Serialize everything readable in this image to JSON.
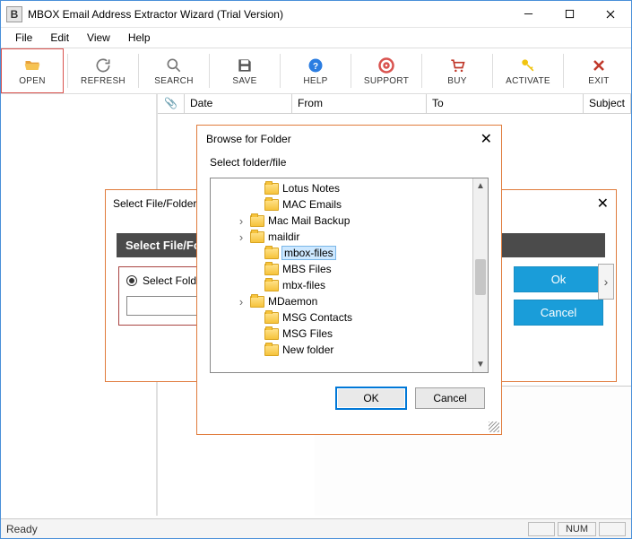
{
  "window": {
    "title": "MBOX Email Address Extractor Wizard (Trial Version)",
    "app_badge": "B"
  },
  "menu": {
    "file": "File",
    "edit": "Edit",
    "view": "View",
    "help": "Help"
  },
  "toolbar": {
    "open": "OPEN",
    "refresh": "REFRESH",
    "search": "SEARCH",
    "save": "SAVE",
    "help": "HELP",
    "support": "SUPPORT",
    "buy": "BUY",
    "activate": "ACTIVATE",
    "exit": "EXIT"
  },
  "columns": {
    "date": "Date",
    "from": "From",
    "to": "To",
    "subject": "Subject"
  },
  "status": {
    "ready": "Ready",
    "num": "NUM"
  },
  "select_dialog": {
    "title": "Select File/Folder",
    "header": "Select File/Folder",
    "radio_label": "Select Folder",
    "input_value": "",
    "ok": "Ok",
    "cancel": "Cancel"
  },
  "browse_dialog": {
    "title": "Browse for Folder",
    "subtitle": "Select folder/file",
    "items": [
      {
        "label": "Lotus Notes",
        "hasArrow": false
      },
      {
        "label": "MAC Emails",
        "hasArrow": false
      },
      {
        "label": "Mac Mail Backup",
        "hasArrow": true
      },
      {
        "label": "maildir",
        "hasArrow": true
      },
      {
        "label": "mbox-files",
        "hasArrow": false,
        "selected": true
      },
      {
        "label": "MBS Files",
        "hasArrow": false
      },
      {
        "label": "mbx-files",
        "hasArrow": false
      },
      {
        "label": "MDaemon",
        "hasArrow": true
      },
      {
        "label": "MSG Contacts",
        "hasArrow": false
      },
      {
        "label": "MSG Files",
        "hasArrow": false
      },
      {
        "label": "New folder",
        "hasArrow": false
      }
    ],
    "ok": "OK",
    "cancel": "Cancel"
  }
}
